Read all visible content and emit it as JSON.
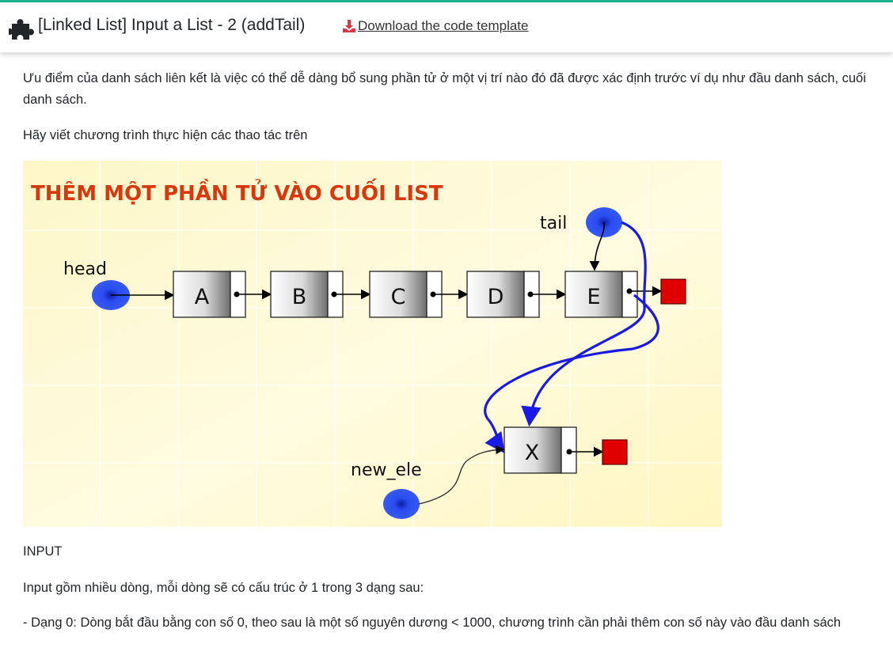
{
  "header": {
    "title": "[Linked List] Input a List - 2 (addTail)",
    "download_label": "Download the code template"
  },
  "content": {
    "p1": "Ưu điểm của danh sách liên kết là việc có thể dễ dàng bổ sung phần tử ở một vị trí nào đó đã được xác định trước ví dụ như đầu danh sách, cuối danh sách.",
    "p2": "Hãy viết chương trình thực hiện các thao tác trên",
    "p3": "INPUT",
    "p4": "Input gồm nhiều dòng, mỗi dòng sẽ có cấu trúc ở 1 trong 3 dạng sau:",
    "p5": "- Dạng 0: Dòng bắt đầu bằng con số 0, theo sau là một số nguyên dương < 1000, chương trình cần phải thêm con số này vào đầu danh sách"
  },
  "figure": {
    "title": "THÊM MỘT PHẦN TỬ VÀO CUỐI LIST",
    "head_label": "head",
    "tail_label": "tail",
    "new_label": "new_ele",
    "nodes": [
      "A",
      "B",
      "C",
      "D",
      "E"
    ],
    "new_node": "X",
    "colors": {
      "title": "#d9380f",
      "pointer": "#1f3fe0",
      "arrow": "#1a1ae6",
      "null_box": "#e00000"
    }
  }
}
